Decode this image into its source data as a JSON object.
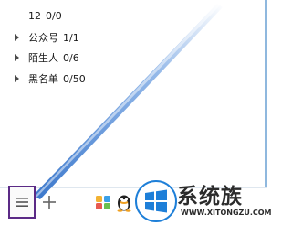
{
  "groups": [
    {
      "name": "12",
      "count": "0/0"
    },
    {
      "name": "公众号",
      "count": "1/1"
    },
    {
      "name": "陌生人",
      "count": "0/6"
    },
    {
      "name": "黑名单",
      "count": "0/50"
    }
  ],
  "bottom_bar": {
    "menu_icon": "hamburger-menu-icon",
    "add_icon": "plus-icon",
    "apps": [
      "apps-grid-icon",
      "penguin-icon"
    ]
  },
  "watermark": {
    "text": "系统族",
    "url": "WWW.XITONGZU.COM"
  },
  "colors": {
    "highlight_border": "#5b2a86",
    "beam": "#3d7fd6",
    "windows_logo": "#1e7fd8"
  }
}
